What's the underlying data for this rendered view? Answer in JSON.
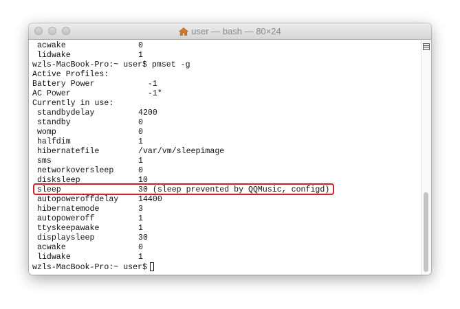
{
  "window": {
    "title": "user — bash — 80×24"
  },
  "terminal": {
    "lines": [
      {
        "k": " acwake",
        "v": "0"
      },
      {
        "k": " lidwake",
        "v": "1"
      },
      {
        "text": "wzls-MacBook-Pro:~ user$ pmset -g"
      },
      {
        "text": "Active Profiles:"
      },
      {
        "k": "Battery Power",
        "v": "  -1"
      },
      {
        "k": "AC Power",
        "v": "  -1*"
      },
      {
        "text": "Currently in use:"
      },
      {
        "k": " standbydelay",
        "v": "4200"
      },
      {
        "k": " standby",
        "v": "0"
      },
      {
        "k": " womp",
        "v": "0"
      },
      {
        "k": " halfdim",
        "v": "1"
      },
      {
        "k": " hibernatefile",
        "v": "/var/vm/sleepimage"
      },
      {
        "k": " sms",
        "v": "1"
      },
      {
        "k": " networkoversleep",
        "v": "0"
      },
      {
        "k": " disksleep",
        "v": "10"
      },
      {
        "k": " sleep",
        "v": "30 (sleep prevented by QQMusic, configd)"
      },
      {
        "k": " autopoweroffdelay",
        "v": "14400"
      },
      {
        "k": " hibernatemode",
        "v": "3"
      },
      {
        "k": " autopoweroff",
        "v": "1"
      },
      {
        "k": " ttyskeepawake",
        "v": "1"
      },
      {
        "k": " displaysleep",
        "v": "30"
      },
      {
        "k": " acwake",
        "v": "0"
      },
      {
        "k": " lidwake",
        "v": "1"
      },
      {
        "text": "wzls-MacBook-Pro:~ user$"
      }
    ]
  },
  "icons": {
    "home": "home-icon",
    "scroll_top": "split-pane-icon"
  },
  "colors": {
    "highlight": "#cf2028",
    "home_icon": "#d07a2b"
  }
}
